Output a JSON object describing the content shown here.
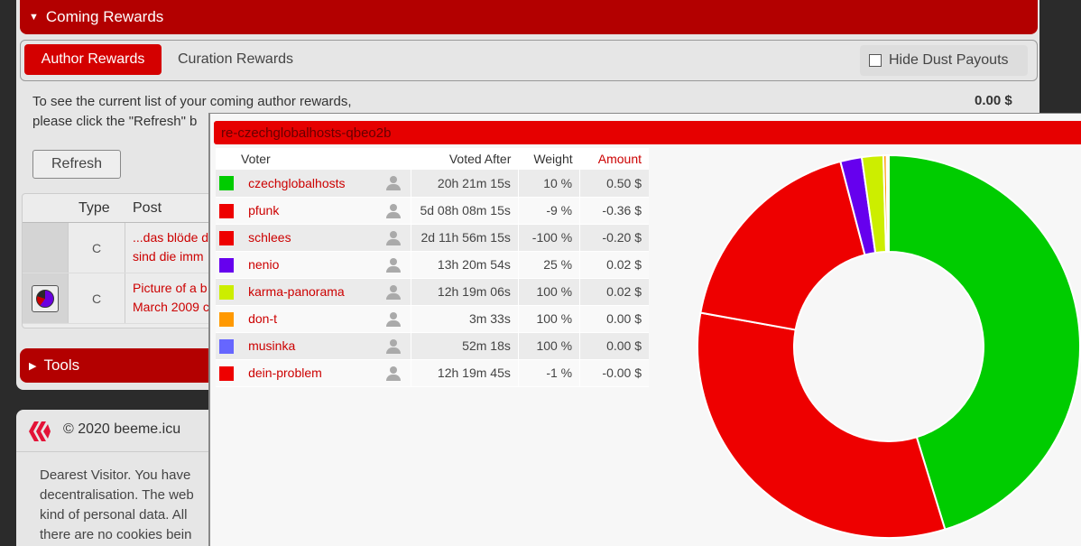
{
  "coming_rewards": {
    "title": "Coming Rewards"
  },
  "tabs": {
    "author": "Author Rewards",
    "curation": "Curation Rewards",
    "hide_dust": "Hide Dust Payouts"
  },
  "info": {
    "line1": "To see the current list of your coming author rewards,",
    "line2": "please click the \"Refresh\" b",
    "total": "0.00 $",
    "refresh_label": "Refresh"
  },
  "posts": {
    "headers": {
      "type": "Type",
      "post": "Post"
    },
    "rows": [
      {
        "type": "C",
        "line1": "...das blöde d",
        "line2": "sind die imm"
      },
      {
        "type": "C",
        "line1": "Picture of a b",
        "line2": "March 2009 c"
      }
    ]
  },
  "tools": {
    "title": "Tools"
  },
  "footer": {
    "copyright": "© 2020 beeme.icu",
    "lines": [
      "Dearest Visitor. You have",
      "decentralisation. The web",
      "kind of personal data. All",
      "there are no cookies bein"
    ]
  },
  "popup": {
    "title": "re-czechglobalhosts-qbeo2b",
    "headers": {
      "voter": "Voter",
      "voted_after": "Voted After",
      "weight": "Weight",
      "amount": "Amount"
    },
    "votes": [
      {
        "voter": "czechglobalhosts",
        "voted_after": "20h 21m 15s",
        "weight": "10 %",
        "amount": "0.50 $",
        "color": "#00cc00"
      },
      {
        "voter": "pfunk",
        "voted_after": "5d 08h 08m 15s",
        "weight": "-9 %",
        "amount": "-0.36 $",
        "color": "#ee0000"
      },
      {
        "voter": "schlees",
        "voted_after": "2d 11h 56m 15s",
        "weight": "-100 %",
        "amount": "-0.20 $",
        "color": "#ee0000"
      },
      {
        "voter": "nenio",
        "voted_after": "13h 20m 54s",
        "weight": "25 %",
        "amount": "0.02 $",
        "color": "#6600ee"
      },
      {
        "voter": "karma-panorama",
        "voted_after": "12h 19m 06s",
        "weight": "100 %",
        "amount": "0.02 $",
        "color": "#ccee00"
      },
      {
        "voter": "don-t",
        "voted_after": "3m 33s",
        "weight": "100 %",
        "amount": "0.00 $",
        "color": "#ff9900"
      },
      {
        "voter": "musinka",
        "voted_after": "52m 18s",
        "weight": "100 %",
        "amount": "0.00 $",
        "color": "#6666ff"
      },
      {
        "voter": "dein-problem",
        "voted_after": "12h 19m 45s",
        "weight": "-1 %",
        "amount": "-0.00 $",
        "color": "#ee0000"
      }
    ]
  },
  "chart_data": {
    "type": "pie",
    "categories": [
      "czechglobalhosts",
      "pfunk",
      "schlees",
      "nenio",
      "karma-panorama",
      "don-t",
      "musinka",
      "dein-problem"
    ],
    "values": [
      0.5,
      0.36,
      0.2,
      0.02,
      0.02,
      0.003,
      0.001,
      0.001
    ],
    "colors": [
      "#00cc00",
      "#ee0000",
      "#ee0000",
      "#6600ee",
      "#ccee00",
      "#ff9900",
      "#6666ff",
      "#ee0000"
    ],
    "title": "",
    "donut": true
  }
}
